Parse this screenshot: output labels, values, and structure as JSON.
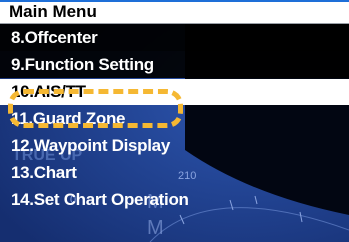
{
  "menu": {
    "title": "Main Menu",
    "items": [
      {
        "label": "8.Offcenter",
        "selected": false
      },
      {
        "label": "9.Function Setting",
        "selected": false
      },
      {
        "label": "10.AIS/TT",
        "selected": true
      },
      {
        "label": "11.Guard Zone",
        "selected": false
      },
      {
        "label": "12.Waypoint Display",
        "selected": false
      },
      {
        "label": "13.Chart",
        "selected": false
      },
      {
        "label": "14.Set Chart Operation",
        "selected": false
      }
    ]
  },
  "background": {
    "labels": [
      "TRUE UP",
      "210",
      "0",
      "M",
      "M"
    ]
  },
  "colors": {
    "highlight_ring": "#f5b833",
    "title_bar_bg": "#ffffff",
    "title_bar_accent": "#1e6fd8",
    "menu_bg": "#000000",
    "radar_bg": "#1f3f8c",
    "selected_bg": "#ffffff"
  }
}
